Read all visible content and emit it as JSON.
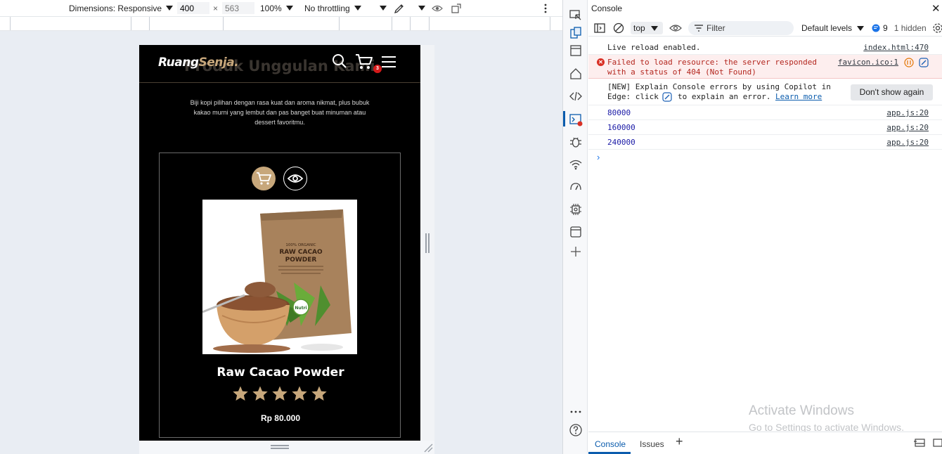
{
  "device_toolbar": {
    "dimensions_label": "Dimensions: Responsive",
    "width": "400",
    "times": "×",
    "height": "563",
    "zoom": "100%",
    "throttling": "No throttling"
  },
  "site": {
    "logo_main": "Ruang",
    "logo_accent": "Senja.",
    "ghost_title": "Produk Unggulan Kami",
    "cart_count": "3",
    "subtitle": "Biji kopi pilihan dengan rasa kuat dan aroma nikmat, plus bubuk kakao murni yang lembut dan pas banget buat minuman atau dessert favoritmu.",
    "product": {
      "package_line1": "100% ORGANIC",
      "package_line2": "RAW CACAO",
      "package_line3": "POWDER",
      "package_brand": "Nutri",
      "name": "Raw Cacao Powder",
      "rating": 5,
      "rating_max": 5,
      "price": "Rp 80.000"
    }
  },
  "devtools": {
    "panel_title": "Console",
    "context": "top",
    "filter_placeholder": "Filter",
    "levels": "Default levels",
    "issue_count": "9",
    "hidden": "1 hidden",
    "messages": [
      {
        "text": "Live reload enabled.",
        "source": "index.html:470"
      },
      {
        "text_line1": "Failed to load resource: the server responded",
        "text_line2": "with a status of 404 (Not Found)",
        "source": "favicon.ico:1"
      },
      {
        "text_line1": "[NEW] Explain Console errors by using Copilot in",
        "text_line2_a": "Edge: click",
        "text_line2_b": "to explain an error.",
        "link": "Learn more",
        "button": "Don't show again"
      },
      {
        "text": "80000",
        "source": "app.js:20"
      },
      {
        "text": "160000",
        "source": "app.js:20"
      },
      {
        "text": "240000",
        "source": "app.js:20"
      }
    ],
    "prompt": "›",
    "watermark_title": "Activate Windows",
    "watermark_sub": "Go to Settings to activate Windows.",
    "bottom_tabs": {
      "console": "Console",
      "issues": "Issues",
      "add": "+"
    }
  },
  "colors": {
    "accent": "#c7a77b",
    "badge": "#d41a1a",
    "link": "#0b5cad",
    "error_bg": "#fdeeee"
  }
}
